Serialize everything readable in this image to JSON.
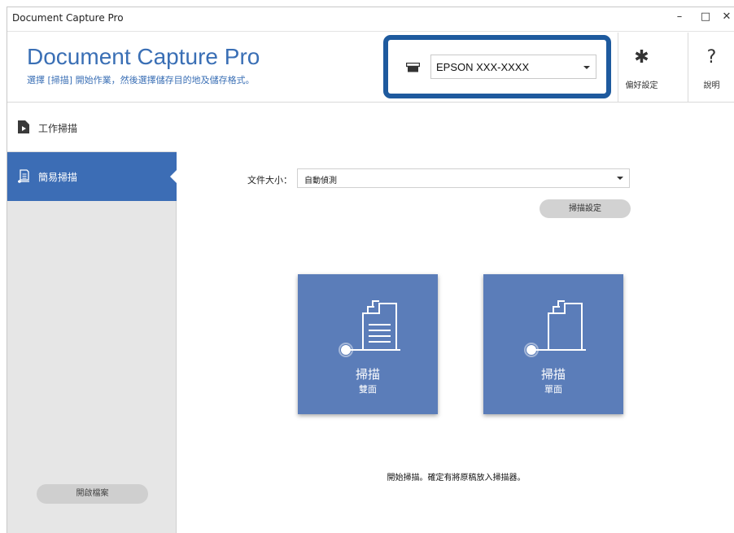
{
  "window": {
    "title": "Document Capture Pro",
    "controls": {
      "minimize": "–",
      "maximize": "□",
      "close": "✕"
    }
  },
  "header": {
    "app_title": "Document Capture Pro",
    "subtitle": "選擇 [掃描] 開始作業，然後選擇儲存目的地及儲存格式。",
    "scanner": {
      "selected": "EPSON XXX-XXXX",
      "icon": "scanner-icon"
    },
    "preferences": {
      "label": "偏好設定",
      "icon": "gear-icon"
    },
    "help": {
      "label": "說明",
      "icon": "help-icon"
    }
  },
  "sidebar": {
    "items": [
      {
        "label": "工作掃描",
        "icon": "job-scan-icon",
        "active": false
      },
      {
        "label": "簡易掃描",
        "icon": "simple-scan-icon",
        "active": true
      }
    ],
    "open_file_label": "開啟檔案"
  },
  "main": {
    "document_size_label": "文件大小：",
    "document_size_value": "自動偵測",
    "scan_settings_label": "掃描設定",
    "tiles": [
      {
        "title": "掃描",
        "subtitle": "雙面",
        "icon": "duplex-scan-icon"
      },
      {
        "title": "掃描",
        "subtitle": "單面",
        "icon": "simplex-scan-icon"
      }
    ],
    "hint": "開始掃描。確定有將原稿放入掃描器。"
  },
  "colors": {
    "accent": "#3c6db5",
    "title_blue": "#3a6fb5",
    "tile": "#5b7db9",
    "highlight_border": "#1e5a9e"
  }
}
